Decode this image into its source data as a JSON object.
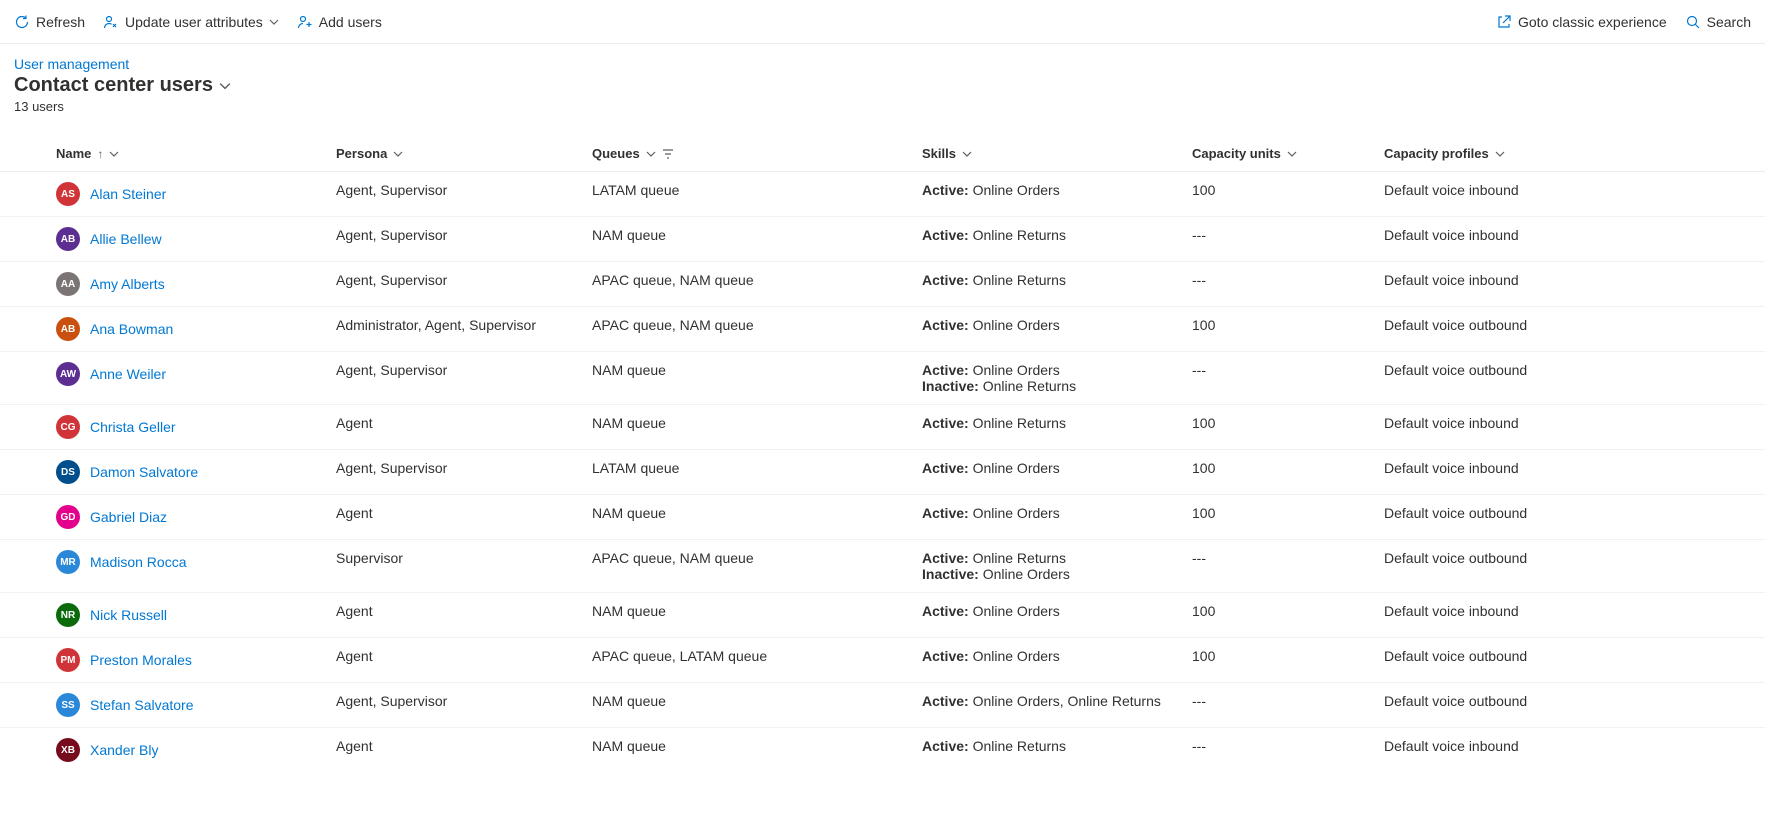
{
  "commands": {
    "refresh": "Refresh",
    "update_attrs": "Update user attributes",
    "add_users": "Add users",
    "goto_classic": "Goto classic experience",
    "search": "Search"
  },
  "breadcrumb": {
    "user_management": "User management"
  },
  "page": {
    "title": "Contact center users",
    "subtitle": "13 users"
  },
  "columns": {
    "name": "Name",
    "persona": "Persona",
    "queues": "Queues",
    "skills": "Skills",
    "capacity_units": "Capacity units",
    "capacity_profiles": "Capacity profiles"
  },
  "skill_labels": {
    "active": "Active:",
    "inactive": "Inactive:"
  },
  "rows": [
    {
      "initials": "AS",
      "color": "#d13438",
      "name": "Alan Steiner",
      "persona": "Agent, Supervisor",
      "queues": "LATAM queue",
      "skills_active": "Online Orders",
      "skills_inactive": "",
      "capacity_units": "100",
      "capacity_profiles": "Default voice inbound"
    },
    {
      "initials": "AB",
      "color": "#5c2e91",
      "name": "Allie Bellew",
      "persona": "Agent, Supervisor",
      "queues": "NAM queue",
      "skills_active": "Online Returns",
      "skills_inactive": "",
      "capacity_units": "---",
      "capacity_profiles": "Default voice inbound"
    },
    {
      "initials": "AA",
      "color": "#7a7574",
      "name": "Amy Alberts",
      "persona": "Agent, Supervisor",
      "queues": "APAC queue, NAM queue",
      "skills_active": "Online Returns",
      "skills_inactive": "",
      "capacity_units": "---",
      "capacity_profiles": "Default voice inbound"
    },
    {
      "initials": "AB",
      "color": "#ca5010",
      "name": "Ana Bowman",
      "persona": "Administrator, Agent, Supervisor",
      "queues": "APAC queue, NAM queue",
      "skills_active": "Online Orders",
      "skills_inactive": "",
      "capacity_units": "100",
      "capacity_profiles": "Default voice outbound"
    },
    {
      "initials": "AW",
      "color": "#5c2e91",
      "name": "Anne Weiler",
      "persona": "Agent, Supervisor",
      "queues": "NAM queue",
      "skills_active": "Online Orders",
      "skills_inactive": "Online Returns",
      "capacity_units": "---",
      "capacity_profiles": "Default voice outbound"
    },
    {
      "initials": "CG",
      "color": "#d13438",
      "name": "Christa Geller",
      "persona": "Agent",
      "queues": "NAM queue",
      "skills_active": "Online Returns",
      "skills_inactive": "",
      "capacity_units": "100",
      "capacity_profiles": "Default voice inbound"
    },
    {
      "initials": "DS",
      "color": "#004e8c",
      "name": "Damon Salvatore",
      "persona": "Agent, Supervisor",
      "queues": "LATAM queue",
      "skills_active": "Online Orders",
      "skills_inactive": "",
      "capacity_units": "100",
      "capacity_profiles": "Default voice inbound"
    },
    {
      "initials": "GD",
      "color": "#e3008c",
      "name": "Gabriel Diaz",
      "persona": "Agent",
      "queues": "NAM queue",
      "skills_active": "Online Orders",
      "skills_inactive": "",
      "capacity_units": "100",
      "capacity_profiles": "Default voice outbound"
    },
    {
      "initials": "MR",
      "color": "#2b88d8",
      "name": "Madison Rocca",
      "persona": "Supervisor",
      "queues": "APAC queue, NAM queue",
      "skills_active": "Online Returns",
      "skills_inactive": "Online Orders",
      "capacity_units": "---",
      "capacity_profiles": "Default voice outbound"
    },
    {
      "initials": "NR",
      "color": "#0b6a0b",
      "name": "Nick Russell",
      "persona": "Agent",
      "queues": "NAM queue",
      "skills_active": "Online Orders",
      "skills_inactive": "",
      "capacity_units": "100",
      "capacity_profiles": "Default voice inbound"
    },
    {
      "initials": "PM",
      "color": "#d13438",
      "name": "Preston Morales",
      "persona": "Agent",
      "queues": "APAC queue, LATAM queue",
      "skills_active": "Online Orders",
      "skills_inactive": "",
      "capacity_units": "100",
      "capacity_profiles": "Default voice outbound"
    },
    {
      "initials": "SS",
      "color": "#2b88d8",
      "name": "Stefan Salvatore",
      "persona": "Agent, Supervisor",
      "queues": "NAM queue",
      "skills_active": "Online Orders, Online Returns",
      "skills_inactive": "",
      "capacity_units": "---",
      "capacity_profiles": "Default voice outbound"
    },
    {
      "initials": "XB",
      "color": "#750b1c",
      "name": "Xander Bly",
      "persona": "Agent",
      "queues": "NAM queue",
      "skills_active": "Online Returns",
      "skills_inactive": "",
      "capacity_units": "---",
      "capacity_profiles": "Default voice inbound"
    }
  ]
}
